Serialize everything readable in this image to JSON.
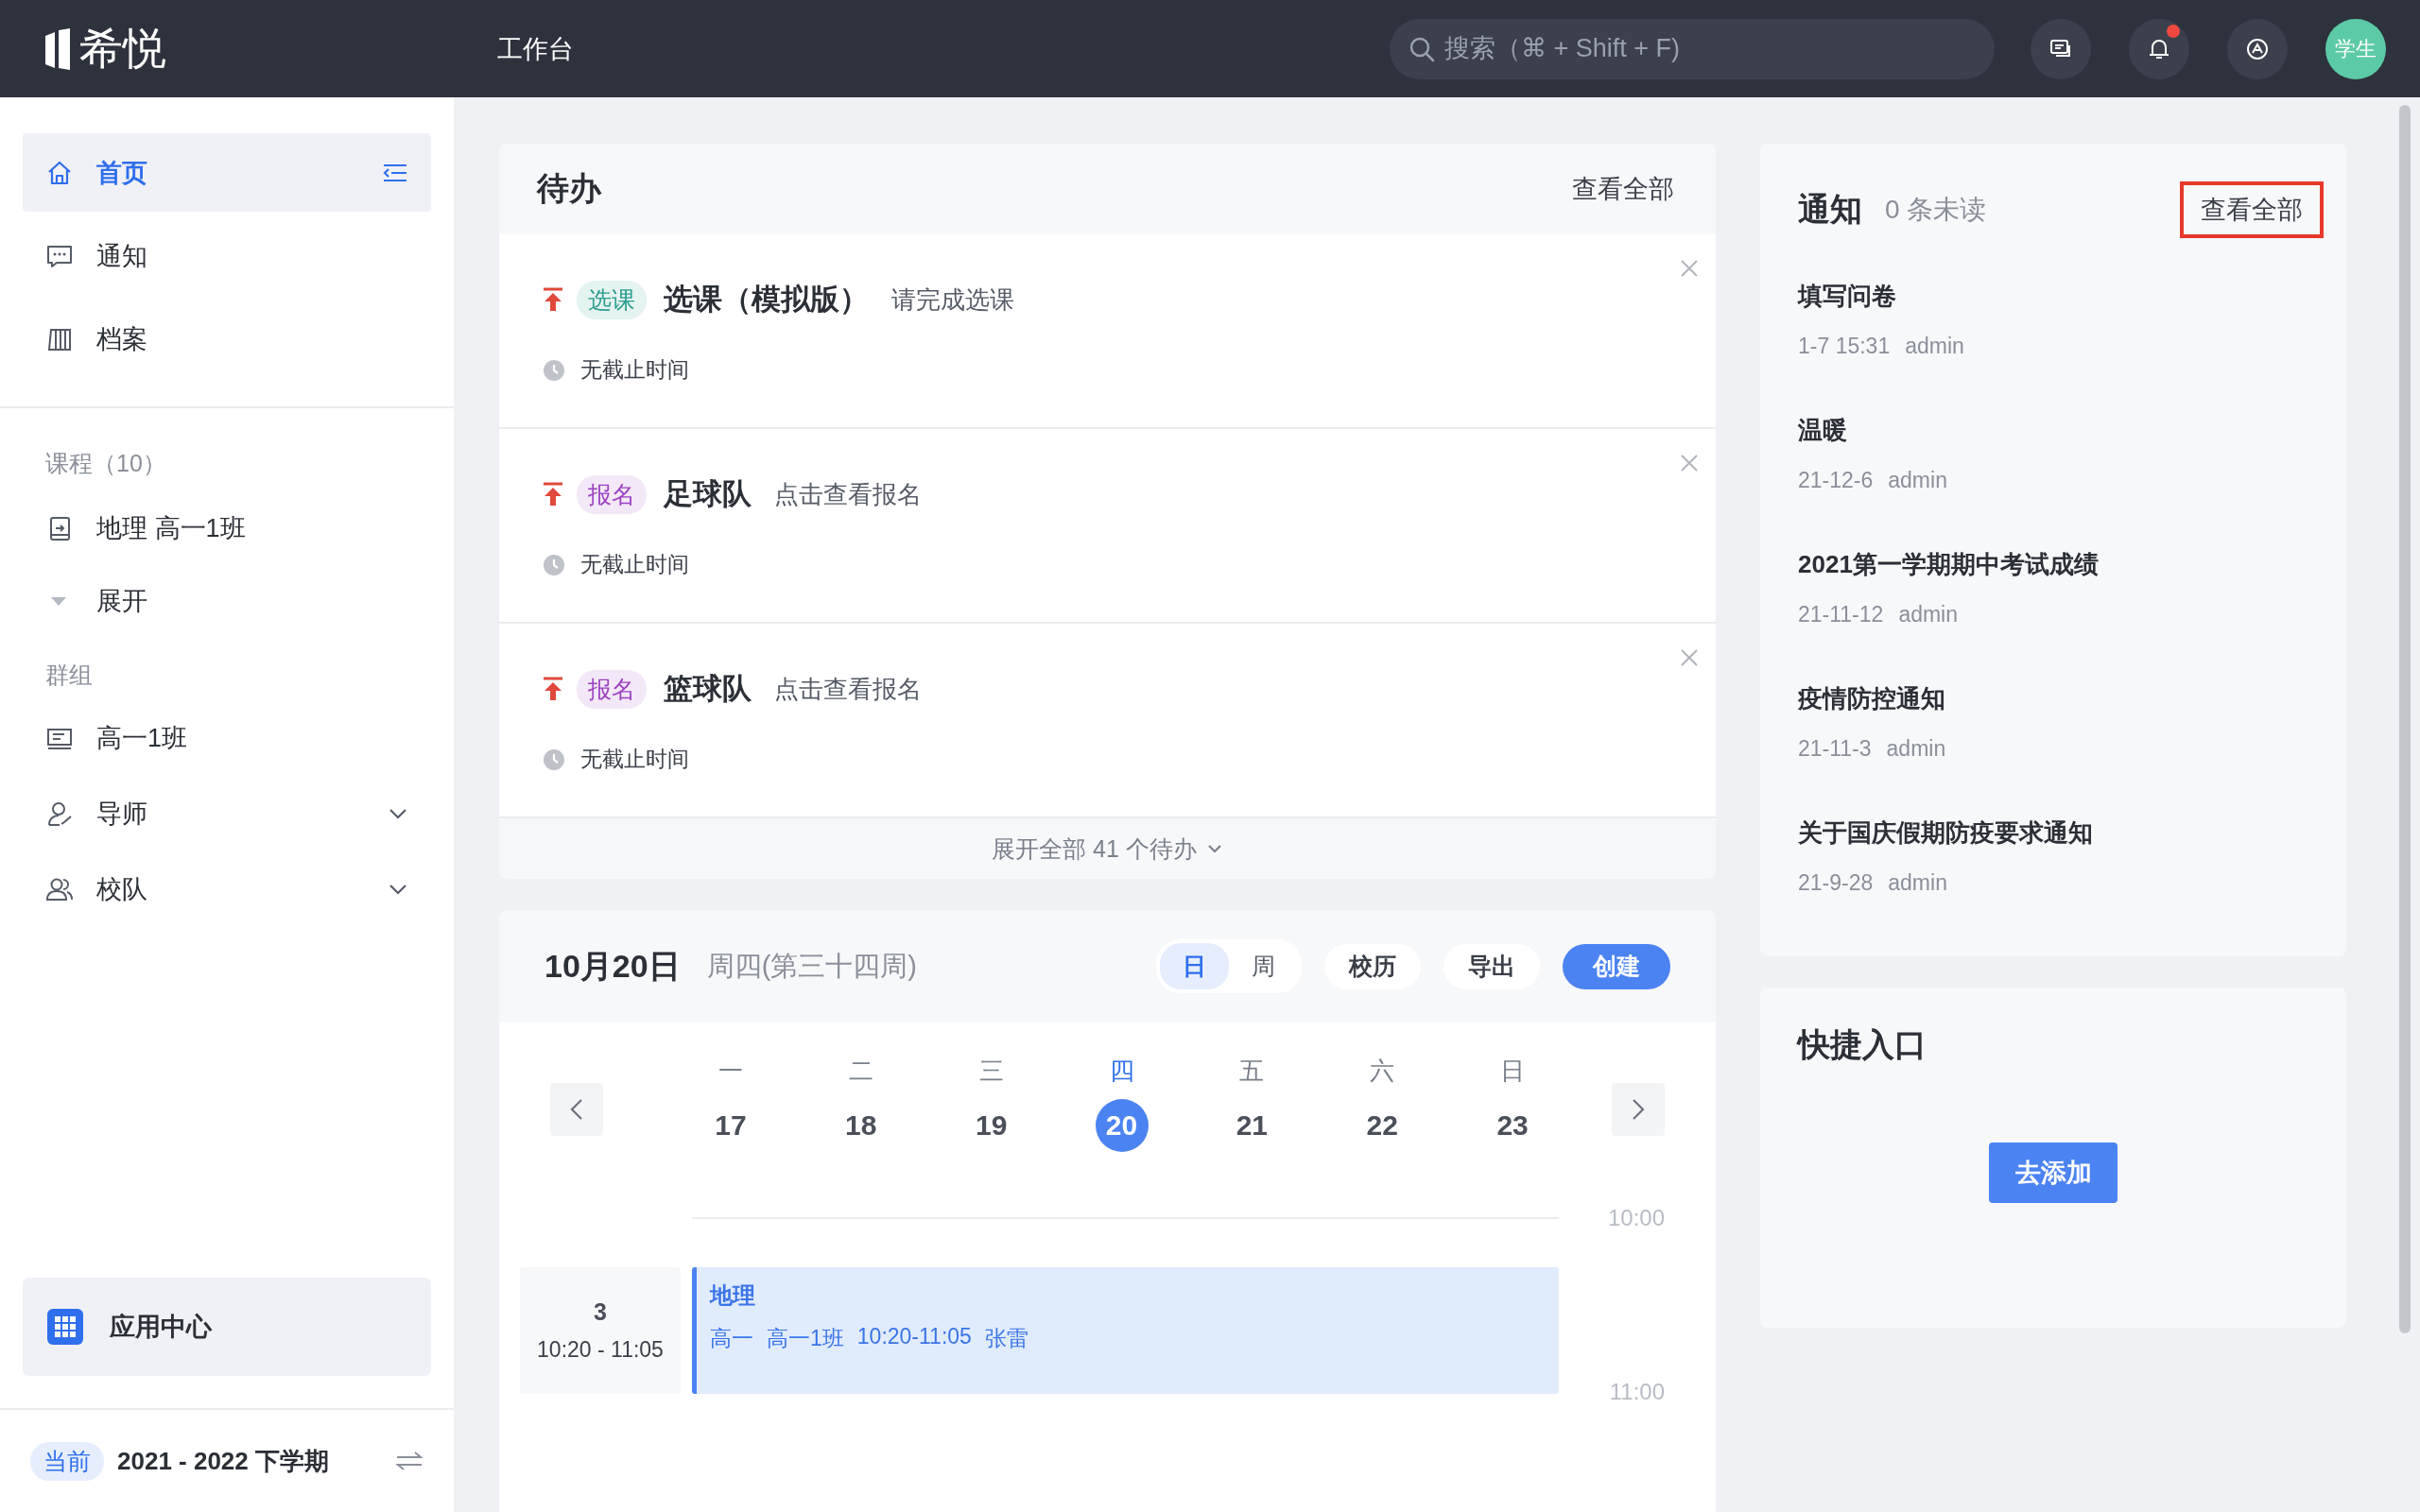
{
  "topbar": {
    "logo": "希悦",
    "title": "工作台",
    "search": {
      "placeholder": "搜索（⌘ + Shift + F)"
    },
    "bell_unread": true,
    "avatar": "学生"
  },
  "sidebar": {
    "items": [
      {
        "label": "首页",
        "selected": true
      },
      {
        "label": "通知",
        "selected": false
      },
      {
        "label": "档案",
        "selected": false
      }
    ],
    "courses": {
      "heading": "课程（10）",
      "items": [
        {
          "label": "地理 高一1班",
          "selected": false
        }
      ],
      "expand": {
        "label": "展开",
        "expanded": false
      }
    },
    "groups": {
      "heading": "群组",
      "items": [
        {
          "label": "高一1班",
          "kind": "plain",
          "selected": false
        },
        {
          "label": "导师",
          "kind": "collapsible",
          "expanded": false,
          "selected": false
        },
        {
          "label": "校队",
          "kind": "collapsible",
          "expanded": false,
          "selected": false
        }
      ]
    },
    "app_center": "应用中心",
    "term": {
      "badge": "当前",
      "label": "2021 - 2022 下学期"
    }
  },
  "todo": {
    "title": "待办",
    "view_all": "查看全部",
    "items": [
      {
        "tag": {
          "text": "选课",
          "color": "#2a9d8f"
        },
        "title": "选课（模拟版）",
        "hint": "请完成选课",
        "deadline": "无截止时间"
      },
      {
        "tag": {
          "text": "报名",
          "color": "#9b3fc0"
        },
        "title": "足球队",
        "hint": "点击查看报名",
        "deadline": "无截止时间"
      },
      {
        "tag": {
          "text": "报名",
          "color": "#9b3fc0"
        },
        "title": "篮球队",
        "hint": "点击查看报名",
        "deadline": "无截止时间"
      }
    ],
    "expand_all": "展开全部 41 个待办"
  },
  "calendar": {
    "date": "10月20日",
    "weekday": "周四(第三十四周)",
    "views": [
      {
        "label": "日",
        "selected": true
      },
      {
        "label": "周",
        "selected": false
      }
    ],
    "buttons": [
      {
        "label": "校历",
        "kind": "plain"
      },
      {
        "label": "导出",
        "kind": "plain"
      },
      {
        "label": "创建",
        "kind": "primary"
      }
    ],
    "days": [
      {
        "weekday": "一",
        "date": "17",
        "selected": false
      },
      {
        "weekday": "二",
        "date": "18",
        "selected": false
      },
      {
        "weekday": "三",
        "date": "19",
        "selected": false
      },
      {
        "weekday": "四",
        "date": "20",
        "selected": true
      },
      {
        "weekday": "五",
        "date": "21",
        "selected": false
      },
      {
        "weekday": "六",
        "date": "22",
        "selected": false
      },
      {
        "weekday": "日",
        "date": "23",
        "selected": false
      }
    ],
    "times": [
      "10:00",
      "11:00"
    ],
    "period": {
      "number": "3",
      "time": "10:20 - 11:05"
    },
    "event": {
      "title": "地理",
      "details": [
        "高一",
        "高一1班",
        "10:20-11:05",
        "张雷"
      ]
    }
  },
  "notices": {
    "title": "通知",
    "unread": "0 条未读",
    "view_all": {
      "label": "查看全部",
      "highlighted": true
    },
    "items": [
      {
        "title": "填写问卷",
        "date": "1-7 15:31",
        "author": "admin"
      },
      {
        "title": "温暖",
        "date": "21-12-6",
        "author": "admin"
      },
      {
        "title": "2021第一学期期中考试成绩",
        "date": "21-11-12",
        "author": "admin"
      },
      {
        "title": "疫情防控通知",
        "date": "21-11-3",
        "author": "admin"
      },
      {
        "title": "关于国庆假期防疫要求通知",
        "date": "21-9-28",
        "author": "admin"
      }
    ]
  },
  "shortcuts": {
    "title": "快捷入口",
    "button": "去添加"
  }
}
